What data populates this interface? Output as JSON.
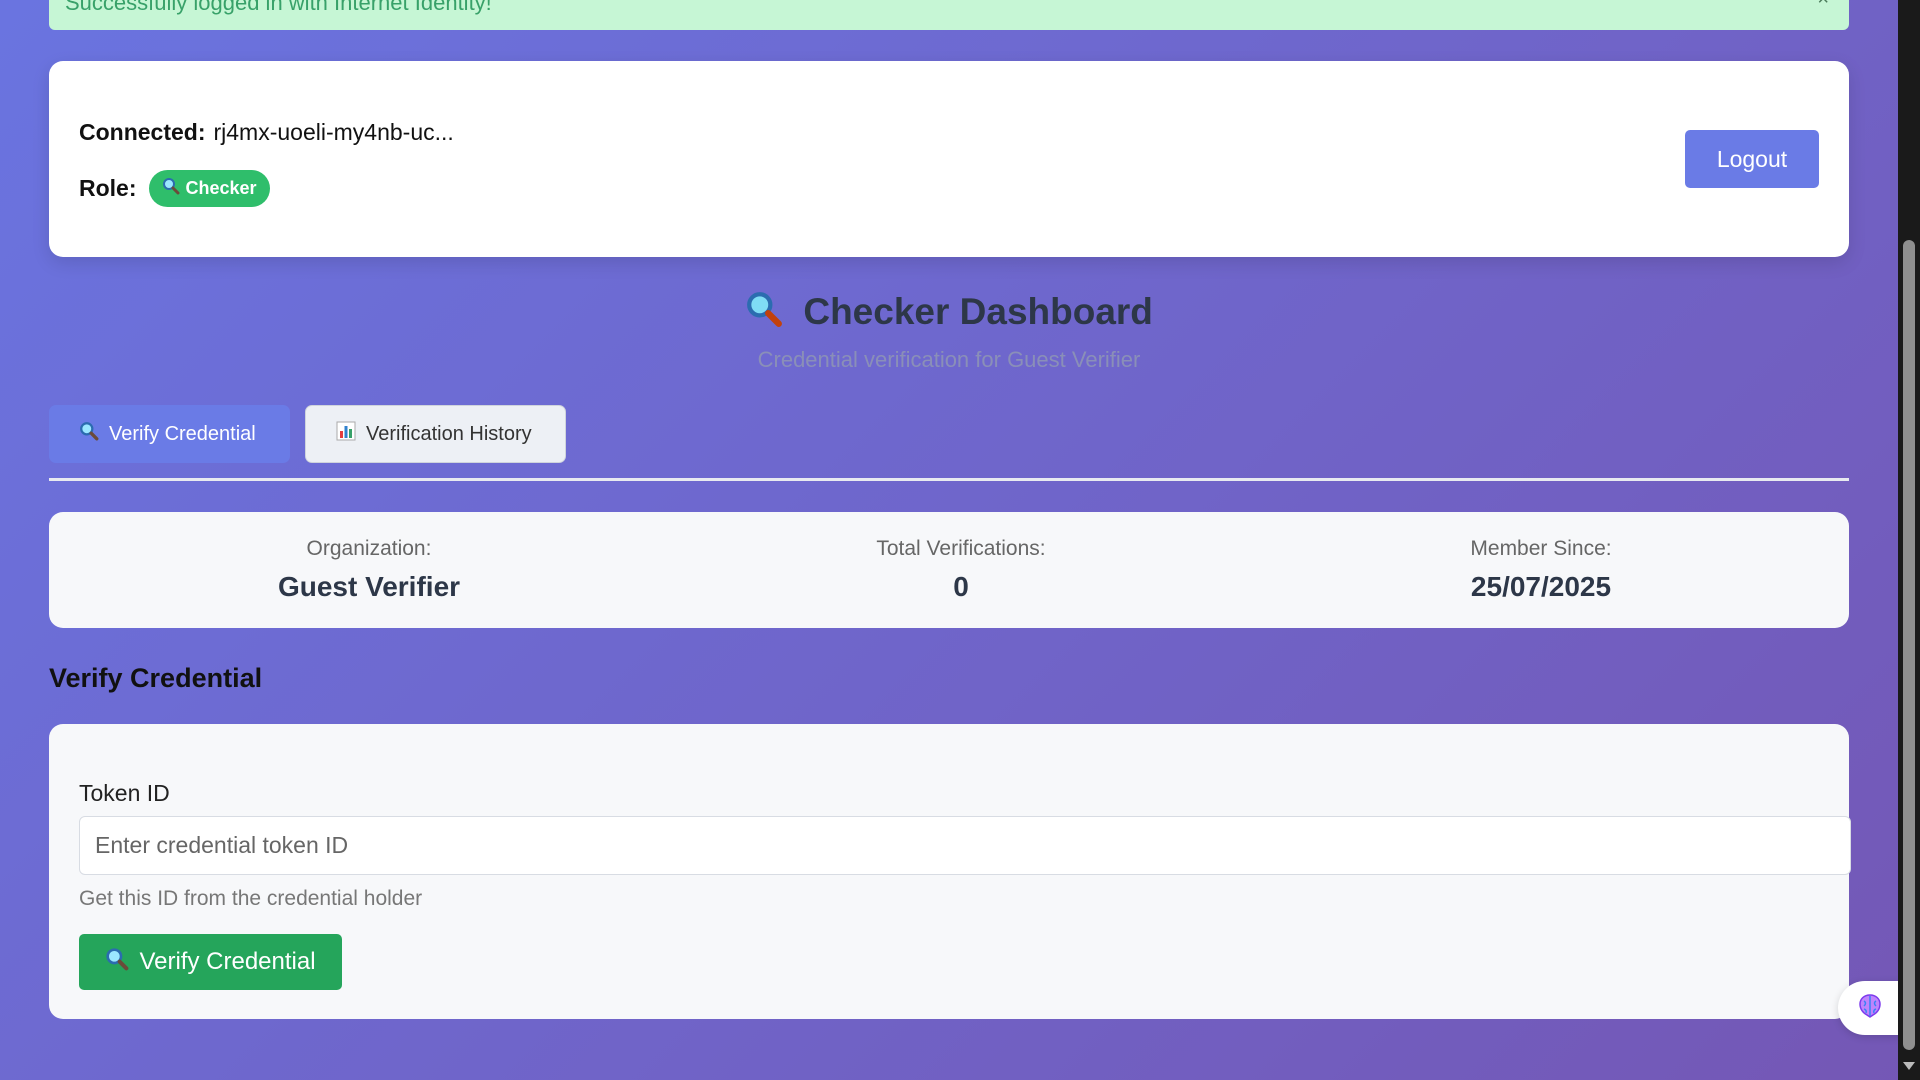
{
  "toast": {
    "message": "Successfully logged in with Internet Identity!",
    "close": "×"
  },
  "connection": {
    "connected_label": "Connected:",
    "principal": "rj4mx-uoeli-my4nb-uc...",
    "role_label": "Role:",
    "role_icon": "magnifier-icon",
    "role": "Checker",
    "logout_label": "Logout"
  },
  "dashboard": {
    "title": "Checker Dashboard",
    "subtitle": "Credential verification for Guest Verifier"
  },
  "tabs": [
    {
      "label": "Verify Credential",
      "icon": "magnifier-icon",
      "active": true
    },
    {
      "label": "Verification History",
      "icon": "bar-chart-icon",
      "active": false
    }
  ],
  "stats": [
    {
      "label": "Organization:",
      "value": "Guest Verifier"
    },
    {
      "label": "Total Verifications:",
      "value": "0"
    },
    {
      "label": "Member Since:",
      "value": "25/07/2025"
    }
  ],
  "verify": {
    "section_title": "Verify Credential",
    "field_label": "Token ID",
    "placeholder": "Enter credential token ID",
    "value": "",
    "helper": "Get this ID from the credential holder",
    "button_label": "Verify Credential"
  },
  "colors": {
    "primary": "#6a7be6",
    "success": "#25a55b",
    "badge": "#2fbe6b",
    "toast_bg": "#c6f6d5",
    "heading": "#2d3748"
  }
}
